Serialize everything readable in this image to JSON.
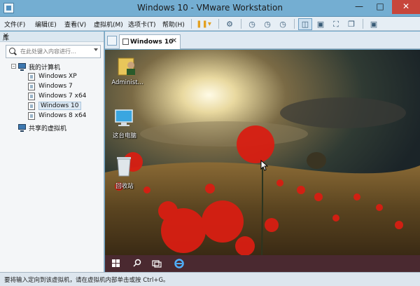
{
  "window": {
    "title": "Windows 10 - VMware Workstation"
  },
  "menu": {
    "items": [
      "文件(F)",
      "编辑(E)",
      "查看(V)",
      "虚拟机(M)",
      "选项卡(T)",
      "帮助(H)"
    ]
  },
  "library": {
    "title": "库",
    "search_placeholder": "在此处键入内容进行...",
    "tree": {
      "root": "我的计算机",
      "vms": [
        "Windows XP",
        "Windows 7",
        "Windows 7 x64",
        "Windows 10",
        "Windows 8 x64"
      ],
      "selected": "Windows 10",
      "shared": "共享的虚拟机"
    }
  },
  "tab": {
    "label": "Windows 10"
  },
  "desktop": {
    "icons": [
      "Administ...",
      "这台电脑",
      "回收站"
    ]
  },
  "status": {
    "message": "要将输入定向到该虚拟机，请在虚拟机内部单击或按 Ctrl+G。"
  },
  "colors": {
    "titlebar": "#74aed2",
    "close": "#c7463b",
    "poppy": "#d81e12"
  }
}
